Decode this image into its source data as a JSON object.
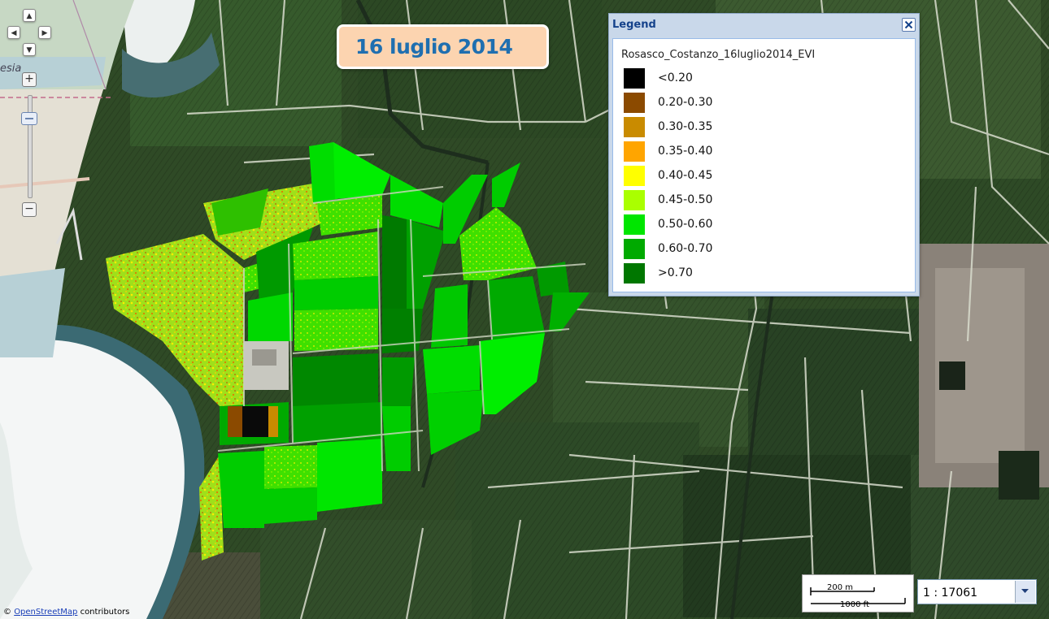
{
  "date_banner": "16 luglio 2014",
  "legend": {
    "title": "Legend",
    "layer_name": "Rosasco_Costanzo_16luglio2014_EVI",
    "items": [
      {
        "label": "<0.20",
        "color": "#000000"
      },
      {
        "label": "0.20-0.30",
        "color": "#8b4a00"
      },
      {
        "label": "0.30-0.35",
        "color": "#c98b00"
      },
      {
        "label": "0.35-0.40",
        "color": "#ffa500"
      },
      {
        "label": "0.40-0.45",
        "color": "#ffff00"
      },
      {
        "label": "0.45-0.50",
        "color": "#aaff00"
      },
      {
        "label": "0.50-0.60",
        "color": "#00e600"
      },
      {
        "label": "0.60-0.70",
        "color": "#00aa00"
      },
      {
        "label": ">0.70",
        "color": "#007700"
      }
    ]
  },
  "scale": {
    "metric_label": "200 m",
    "imperial_label": "1000 ft",
    "ratio": "1 : 17061"
  },
  "attribution": {
    "link": "OpenStreetMap",
    "suffix": " contributors",
    "prefix": "©"
  },
  "base_map_label": "esia",
  "zoom_controls": {
    "plus": "+",
    "minus": "−"
  }
}
